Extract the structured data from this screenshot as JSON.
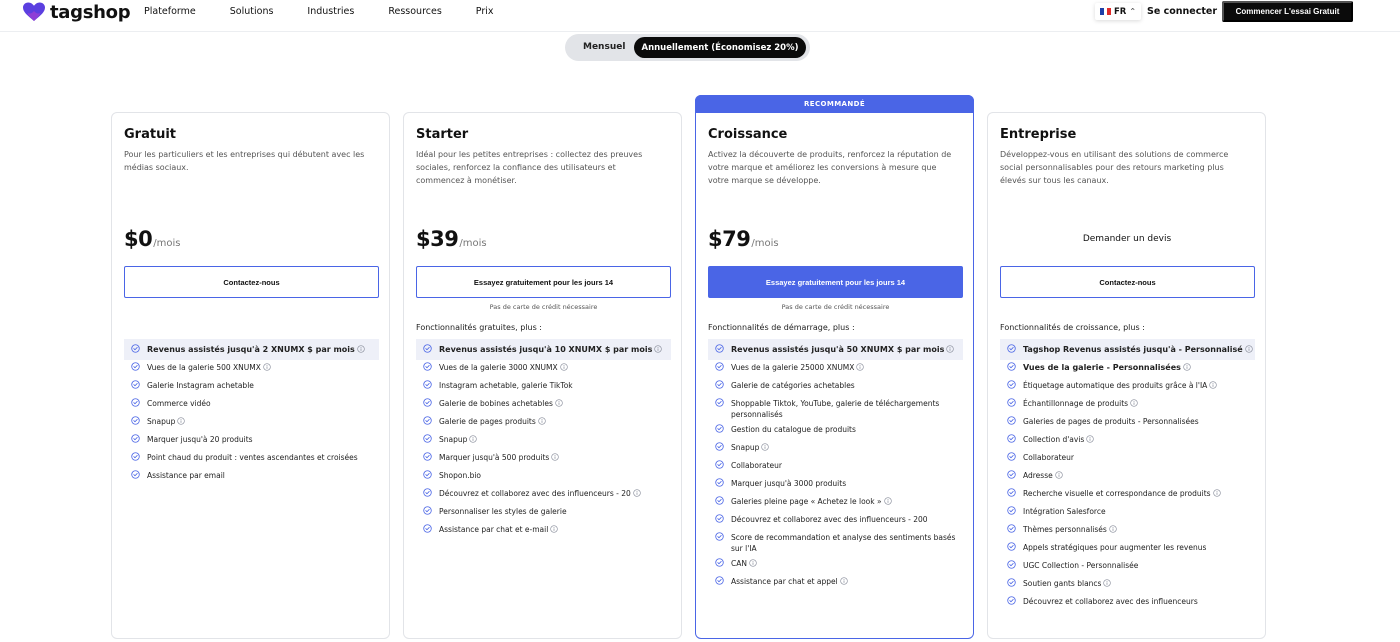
{
  "header": {
    "logo": "tagshop",
    "nav": [
      "Plateforme",
      "Solutions",
      "Industries",
      "Ressources",
      "Prix"
    ],
    "lang": "FR",
    "login": "Se connecter",
    "cta": "Commencer L'essai Gratuit"
  },
  "toggle": {
    "monthly": "Mensuel",
    "annual": "Annuellement (Économisez 20%)"
  },
  "plans": [
    {
      "name": "Gratuit",
      "desc": "Pour les particuliers et les entreprises qui débutent avec les médias sociaux.",
      "price": "$0",
      "per": "/mois",
      "button": "Contactez-nous",
      "features": [
        {
          "label": "Revenus assistés jusqu'à 2 XNUMX $ par mois",
          "info": true,
          "top": true
        },
        {
          "label": "Vues de la galerie 500 XNUMX",
          "info": true
        },
        {
          "label": "Galerie Instagram achetable"
        },
        {
          "label": "Commerce vidéo"
        },
        {
          "label": "Snapup",
          "info": true
        },
        {
          "label": "Marquer jusqu'à 20 produits"
        },
        {
          "label": "Point chaud du produit : ventes ascendantes et croisées"
        },
        {
          "label": "Assistance par email"
        }
      ]
    },
    {
      "name": "Starter",
      "desc": "Idéal pour les petites entreprises : collectez des preuves sociales, renforcez la confiance des utilisateurs et commencez à monétiser.",
      "price": "$39",
      "per": "/mois",
      "button": "Essayez gratuitement pour les jours 14",
      "no_card": "Pas de carte de crédit nécessaire",
      "features_heading": "Fonctionnalités gratuites, plus :",
      "features": [
        {
          "label": "Revenus assistés jusqu'à 10 XNUMX $ par mois",
          "info": true,
          "top": true
        },
        {
          "label": "Vues de la galerie 3000 XNUMX",
          "info": true
        },
        {
          "label": "Instagram achetable, galerie TikTok"
        },
        {
          "label": "Galerie de bobines achetables",
          "info": true
        },
        {
          "label": "Galerie de pages produits",
          "info": true
        },
        {
          "label": "Snapup",
          "info": true
        },
        {
          "label": "Marquer jusqu'à 500 produits",
          "info": true
        },
        {
          "label": "Shopon.bio"
        },
        {
          "label": "Découvrez et collaborez avec des influenceurs - 20",
          "info": true
        },
        {
          "label": "Personnaliser les styles de galerie"
        },
        {
          "label": "Assistance par chat et e-mail",
          "info": true
        }
      ]
    },
    {
      "name": "Croissance",
      "recommended": "RECOMMANDÉ",
      "desc": "Activez la découverte de produits, renforcez la réputation de votre marque et améliorez les conversions à mesure que votre marque se développe.",
      "price": "$79",
      "per": "/mois",
      "button": "Essayez gratuitement pour les jours 14",
      "no_card": "Pas de carte de crédit nécessaire",
      "features_heading": "Fonctionnalités de démarrage, plus :",
      "features": [
        {
          "label": "Revenus assistés jusqu'à 50 XNUMX $ par mois",
          "info": true,
          "top": true
        },
        {
          "label": "Vues de la galerie 25000 XNUMX",
          "info": true
        },
        {
          "label": "Galerie de catégories achetables"
        },
        {
          "label": "Shoppable Tiktok, YouTube, galerie de téléchargements personnalisés"
        },
        {
          "label": "Gestion du catalogue de produits"
        },
        {
          "label": "Snapup",
          "info": true
        },
        {
          "label": "Collaborateur"
        },
        {
          "label": "Marquer jusqu'à 3000 produits"
        },
        {
          "label": "Galeries pleine page « Achetez le look »",
          "info": true
        },
        {
          "label": "Découvrez et collaborez avec des influenceurs - 200"
        },
        {
          "label": "Score de recommandation et analyse des sentiments basés sur l'IA"
        },
        {
          "label": "CAN",
          "info": true
        },
        {
          "label": "Assistance par chat et appel",
          "info": true
        }
      ]
    },
    {
      "name": "Entreprise",
      "desc": "Développez-vous en utilisant des solutions de commerce social personnalisables pour des retours marketing plus élevés sur tous les canaux.",
      "quote": "Demander un devis",
      "button": "Contactez-nous",
      "features_heading": "Fonctionnalités de croissance, plus :",
      "features": [
        {
          "label": "Tagshop Revenus assistés jusqu'à - Personnalisé",
          "info": true,
          "top": true
        },
        {
          "label": "Vues de la galerie - Personnalisées",
          "info": true,
          "strong": true
        },
        {
          "label": "Étiquetage automatique des produits grâce à l'IA",
          "info": true
        },
        {
          "label": "Échantillonnage de produits",
          "info": true
        },
        {
          "label": "Galeries de pages de produits - Personnalisées"
        },
        {
          "label": "Collection d'avis",
          "info": true
        },
        {
          "label": "Collaborateur"
        },
        {
          "label": "Adresse",
          "info": true
        },
        {
          "label": "Recherche visuelle et correspondance de produits",
          "info": true
        },
        {
          "label": "Intégration Salesforce"
        },
        {
          "label": "Thèmes personnalisés",
          "info": true
        },
        {
          "label": "Appels stratégiques pour augmenter les revenus"
        },
        {
          "label": "UGC Collection - Personnalisée"
        },
        {
          "label": "Soutien gants blancs",
          "info": true
        },
        {
          "label": "Découvrez et collaborez avec des influenceurs"
        }
      ]
    }
  ],
  "colors": {
    "accent": "#4a65e6",
    "dark": "#0b0b0b",
    "toggle_bg": "#e2e4e8",
    "feature_highlight": "#eef0f8"
  }
}
